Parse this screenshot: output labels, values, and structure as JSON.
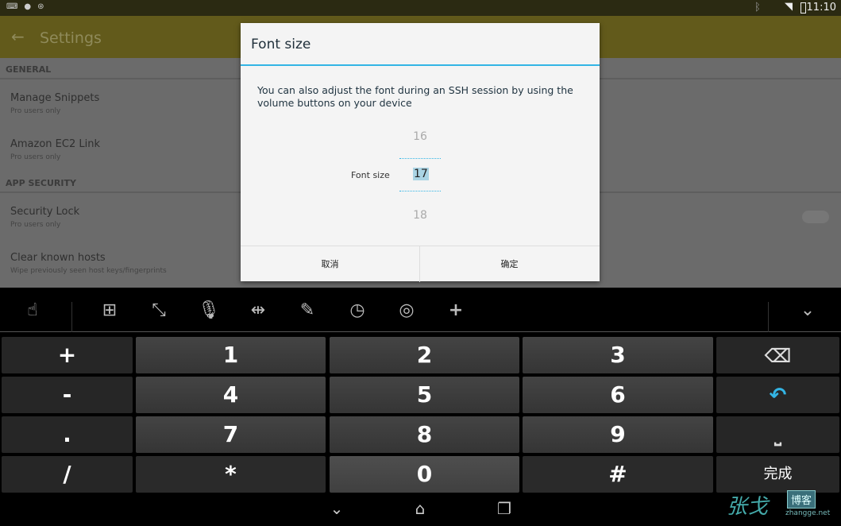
{
  "status_bar": {
    "time": "11:10",
    "left_icons": [
      "keyboard-icon",
      "notification-icon",
      "android-icon"
    ],
    "right_icons": [
      "bluetooth-icon",
      "wifi-icon",
      "battery-icon"
    ]
  },
  "app_bar": {
    "title": "Settings"
  },
  "settings": {
    "sections": [
      {
        "header": "GENERAL",
        "items": [
          {
            "title": "Manage Snippets",
            "subtitle": "Pro users only"
          },
          {
            "title": "Amazon EC2 Link",
            "subtitle": "Pro users only"
          }
        ]
      },
      {
        "header": "APP SECURITY",
        "items": [
          {
            "title": "Security Lock",
            "subtitle": "Pro users only",
            "toggle": false
          },
          {
            "title": "Clear known hosts",
            "subtitle": "Wipe previously seen host keys/fingerprints"
          }
        ]
      }
    ]
  },
  "dialog": {
    "title": "Font size",
    "message": "You can also adjust the font during an SSH session by using the volume buttons on your device",
    "picker_label": "Font size",
    "prev": "16",
    "current": "17",
    "next": "18",
    "cancel": "取消",
    "ok": "确定",
    "accent": "#33b5e5"
  },
  "toolbar": {
    "icons": [
      "gesture-icon",
      "layout-icon",
      "fullscreen-icon",
      "microphone-icon",
      "cursor-icon",
      "pen-icon",
      "clock-icon",
      "weibo-icon",
      "add-icon"
    ],
    "collapse": "chevron-down-icon"
  },
  "keyboard": {
    "rows": [
      [
        "+",
        "1",
        "2",
        "3",
        "backspace"
      ],
      [
        "-",
        "4",
        "5",
        "6",
        "enter"
      ],
      [
        ".",
        "7",
        "8",
        "9",
        "space"
      ],
      [
        "/",
        "*",
        "0",
        "#",
        "完成"
      ]
    ]
  },
  "watermark": {
    "text": "张戈 博客 zhangge.net"
  }
}
